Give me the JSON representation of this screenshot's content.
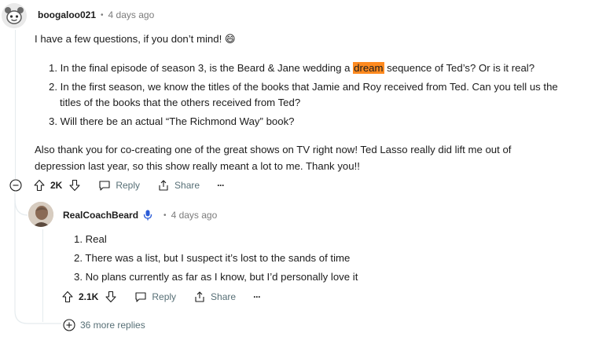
{
  "comment": {
    "author": "boogaloo021",
    "separator": "•",
    "time": "4 days ago",
    "intro": "I have a few questions, if you don’t mind! 😄",
    "items": [
      {
        "num": "1.",
        "before": "In the final episode of season 3, is the Beard & Jane wedding a ",
        "highlight": "dream",
        "after": " sequence of Ted’s? Or is it real?"
      },
      {
        "num": "2.",
        "line1": "In the first season, we know the titles of the books that Jamie and Roy received from Ted. Can you tell us the",
        "line2": "titles of the books that the others received from Ted?"
      },
      {
        "num": "3.",
        "text": "Will there be an actual “The Richmond Way” book?"
      }
    ],
    "outro_line1": "Also thank you for co-creating one of the great shows on TV right now! Ted Lasso really did lift me out of",
    "outro_line2": "depression last year, so this show really meant a lot to me. Thank you!!",
    "votes": "2K",
    "reply_label": "Reply",
    "share_label": "Share",
    "more_label": "···"
  },
  "reply": {
    "author": "RealCoachBeard",
    "separator": "•",
    "time": "4 days ago",
    "items": [
      "1. Real",
      "2. There was a list, but I suspect it’s lost to the sands of time",
      "3. No plans currently as far as I know, but I’d personally love it"
    ],
    "votes": "2.1K",
    "reply_label": "Reply",
    "share_label": "Share",
    "more_label": "···"
  },
  "more_replies": "36 more replies",
  "colors": {
    "highlight": "#ff8a1f",
    "muted": "#576f76",
    "mic": "#2b5bd7"
  }
}
